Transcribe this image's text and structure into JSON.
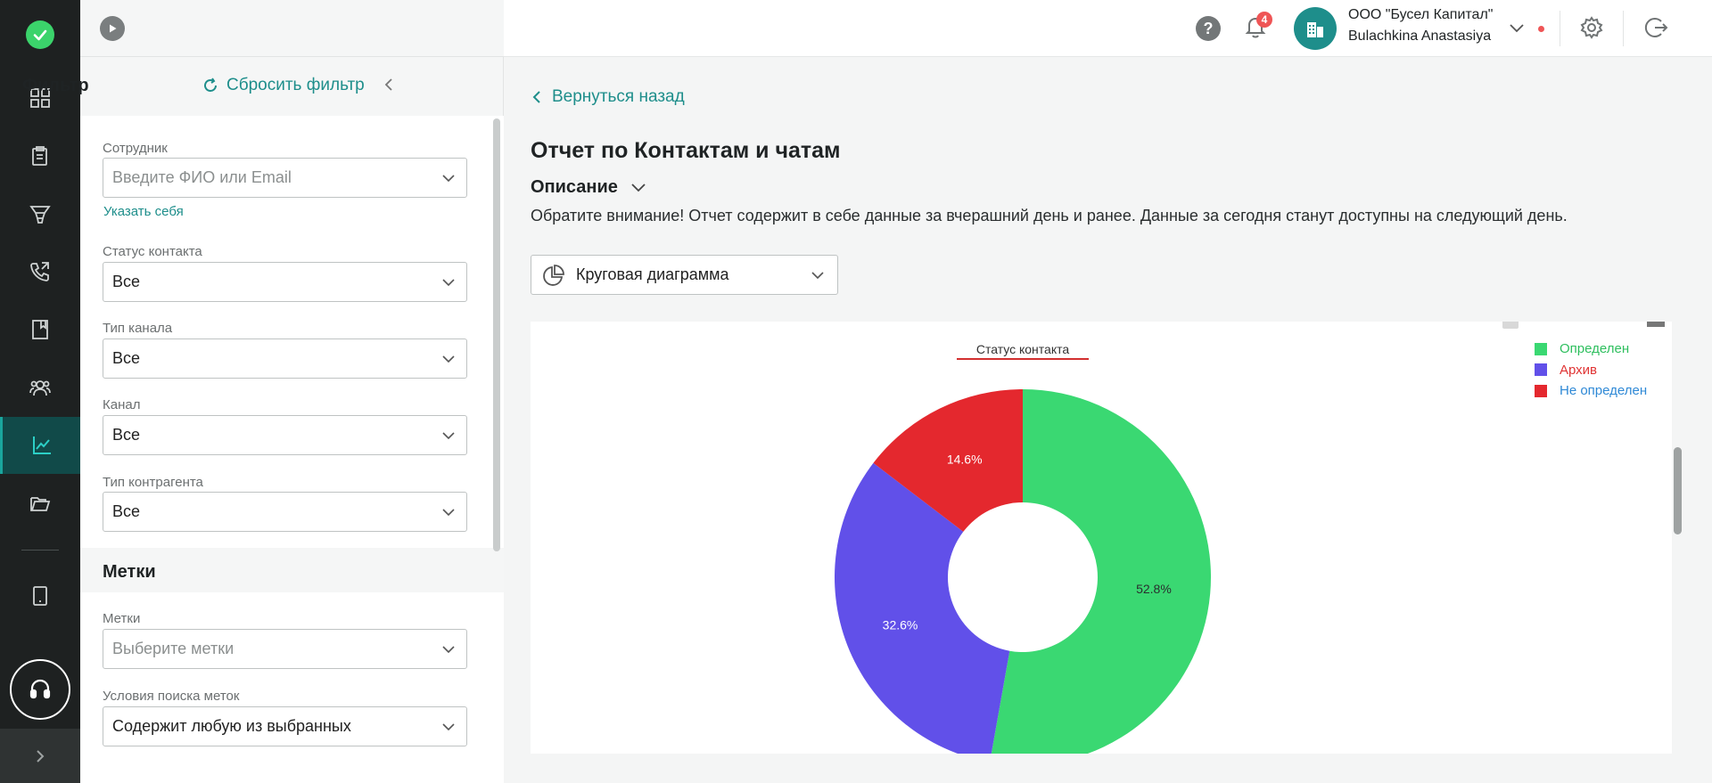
{
  "header": {
    "notifications_count": "4",
    "company": "ООО \"Бусел Капитал\"",
    "user": "Bulachkina Anastasiya"
  },
  "filter": {
    "title": "Фильтр",
    "reset_label": "Сбросить фильтр",
    "employee": {
      "label": "Сотрудник",
      "placeholder": "Введите ФИО или Email",
      "self_link": "Указать себя"
    },
    "contact_status": {
      "label": "Статус контакта",
      "value": "Все"
    },
    "channel_type": {
      "label": "Тип канала",
      "value": "Все"
    },
    "channel": {
      "label": "Канал",
      "value": "Все"
    },
    "counterparty_type": {
      "label": "Тип контрагента",
      "value": "Все"
    },
    "tags_section_title": "Метки",
    "tags": {
      "label": "Метки",
      "placeholder": "Выберите метки"
    },
    "tag_search": {
      "label": "Условия поиска меток",
      "value": "Содержит любую из выбранных"
    }
  },
  "report": {
    "back_label": "Вернуться назад",
    "title": "Отчет по Контактам и чатам",
    "description_label": "Описание",
    "notice": "Обратите внимание! Отчет содержит в себе данные за вчерашний день и ранее. Данные за сегодня станут доступны на следующий день.",
    "chart_type_selector": "Круговая диаграмма"
  },
  "chart_data": {
    "type": "pie",
    "title": "Статус контакта",
    "hole": true,
    "legend_position": "top-right",
    "slices": [
      {
        "label": "Определен",
        "value": 52.8,
        "display": "52.8%",
        "color": "#3ad872",
        "legend_color": "#2ebf5e"
      },
      {
        "label": "Архив",
        "value": 32.6,
        "display": "32.6%",
        "color": "#6150e9",
        "legend_color": "#e03434"
      },
      {
        "label": "Не определен",
        "value": 14.6,
        "display": "14.6%",
        "color": "#e4282e",
        "legend_color": "#2f89d6"
      }
    ]
  },
  "colors": {
    "accent": "#1e8e8b",
    "rail": "#1e2121",
    "rail_active": "#114a49"
  }
}
